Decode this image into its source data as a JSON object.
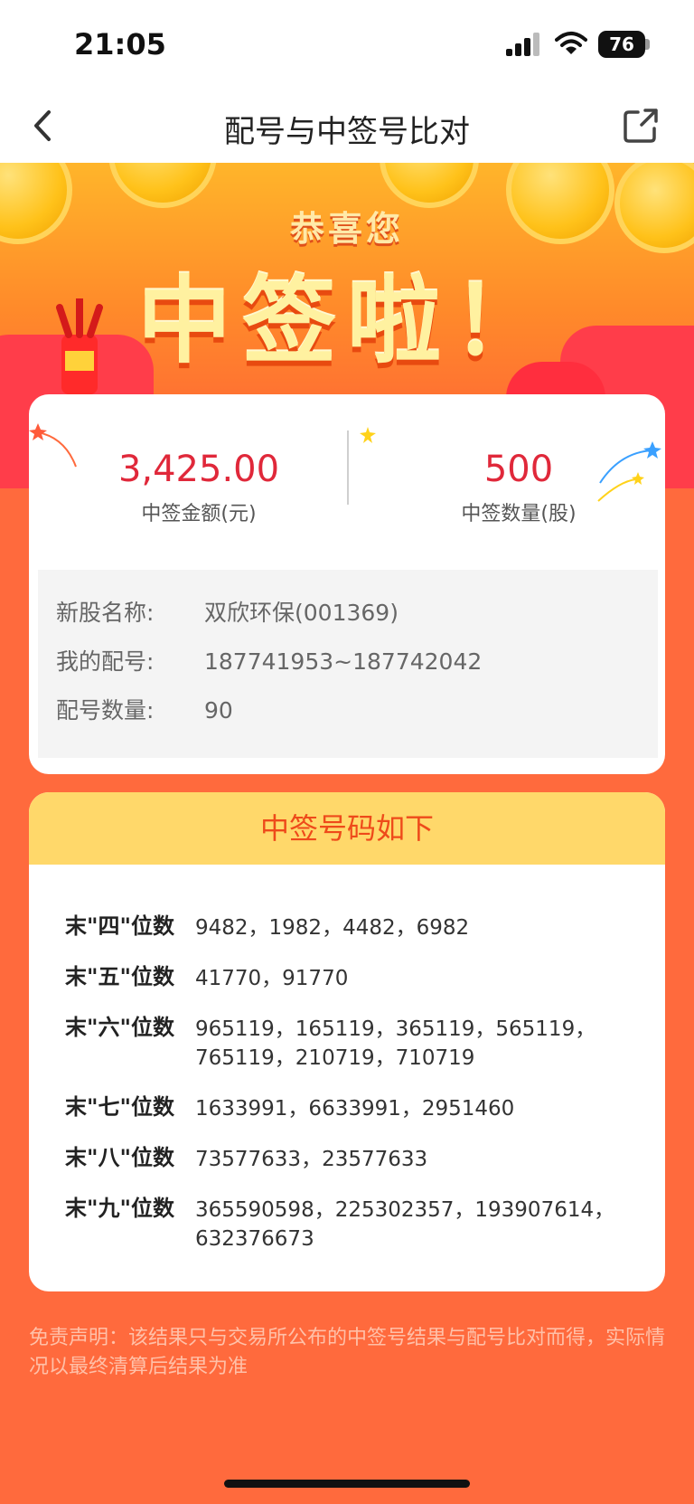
{
  "status": {
    "time": "21:05",
    "battery": "76"
  },
  "nav": {
    "title": "配号与中签号比对"
  },
  "banner": {
    "subtitle": "恭喜您",
    "headline": "中签啦！"
  },
  "summary": {
    "amount_value": "3,425.00",
    "amount_label": "中签金额(元)",
    "shares_value": "500",
    "shares_label": "中签数量(股)"
  },
  "info": {
    "name_key": "新股名称:",
    "name_value": "双欣环保(001369)",
    "range_key": "我的配号:",
    "range_value": "187741953~187742042",
    "count_key": "配号数量:",
    "count_value": "90"
  },
  "winning": {
    "header": "中签号码如下",
    "rows": [
      {
        "label": "末\"四\"位数",
        "numbers": "9482，1982，4482，6982"
      },
      {
        "label": "末\"五\"位数",
        "numbers": "41770，91770"
      },
      {
        "label": "末\"六\"位数",
        "numbers": "965119，165119，365119，565119，765119，210719，710719"
      },
      {
        "label": "末\"七\"位数",
        "numbers": "1633991，6633991，2951460"
      },
      {
        "label": "末\"八\"位数",
        "numbers": "73577633，23577633"
      },
      {
        "label": "末\"九\"位数",
        "numbers": "365590598，225302357，193907614，632376673"
      }
    ]
  },
  "disclaimer": "免责声明：该结果只与交易所公布的中签号结果与配号比对而得，实际情况以最终清算后结果为准"
}
